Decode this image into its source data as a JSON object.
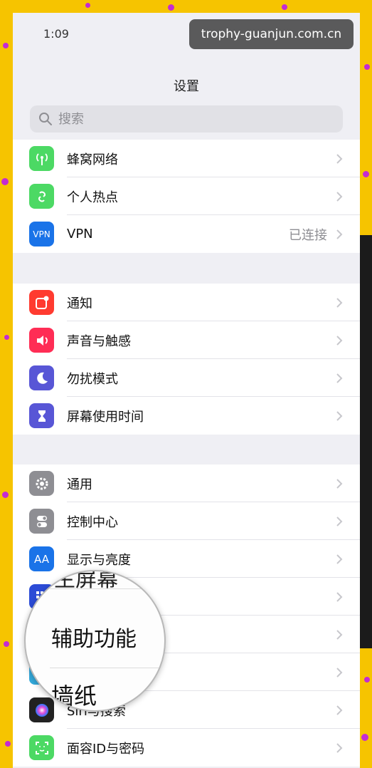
{
  "status": {
    "time": "1:09"
  },
  "watermark": "trophy-guanjun.com.cn",
  "header": {
    "title": "设置"
  },
  "search": {
    "placeholder": "搜索"
  },
  "groups": [
    {
      "items": [
        {
          "label": "蜂窝网络",
          "icon": "antenna-icon",
          "color": "#4cd964"
        },
        {
          "label": "个人热点",
          "icon": "hotspot-chain-icon",
          "color": "#4cd964"
        },
        {
          "label": "VPN",
          "icon": "vpn-icon",
          "icon_text": "VPN",
          "color": "#1a73e8",
          "value": "已连接"
        }
      ]
    },
    {
      "items": [
        {
          "label": "通知",
          "icon": "notification-icon",
          "color": "#ff3b30"
        },
        {
          "label": "声音与触感",
          "icon": "speaker-icon",
          "color": "#ff2d55"
        },
        {
          "label": "勿扰模式",
          "icon": "moon-icon",
          "color": "#5856d6"
        },
        {
          "label": "屏幕使用时间",
          "icon": "hourglass-icon",
          "color": "#5856d6"
        }
      ]
    },
    {
      "items": [
        {
          "label": "通用",
          "icon": "gear-icon",
          "color": "#8e8e93"
        },
        {
          "label": "控制中心",
          "icon": "toggle-switches-icon",
          "color": "#8e8e93"
        },
        {
          "label": "显示与亮度",
          "icon": "text-size-icon",
          "icon_text": "AA",
          "color": "#1a73e8"
        },
        {
          "label": "",
          "icon": "home-screen-icon",
          "color": "#2c4cd6"
        },
        {
          "label": "",
          "icon": "accessibility-icon",
          "color": "#1a73e8"
        },
        {
          "label": "",
          "icon": "wallpaper-icon",
          "color": "#34aadc"
        },
        {
          "label": "Siri与搜索",
          "icon": "siri-icon",
          "color": "#222"
        },
        {
          "label": "面容ID与密码",
          "icon": "face-id-icon",
          "color": "#4cd964"
        }
      ]
    }
  ],
  "magnifier": {
    "top_text": "主屏幕",
    "main_text": "辅助功能",
    "bottom_text": "墙纸"
  }
}
